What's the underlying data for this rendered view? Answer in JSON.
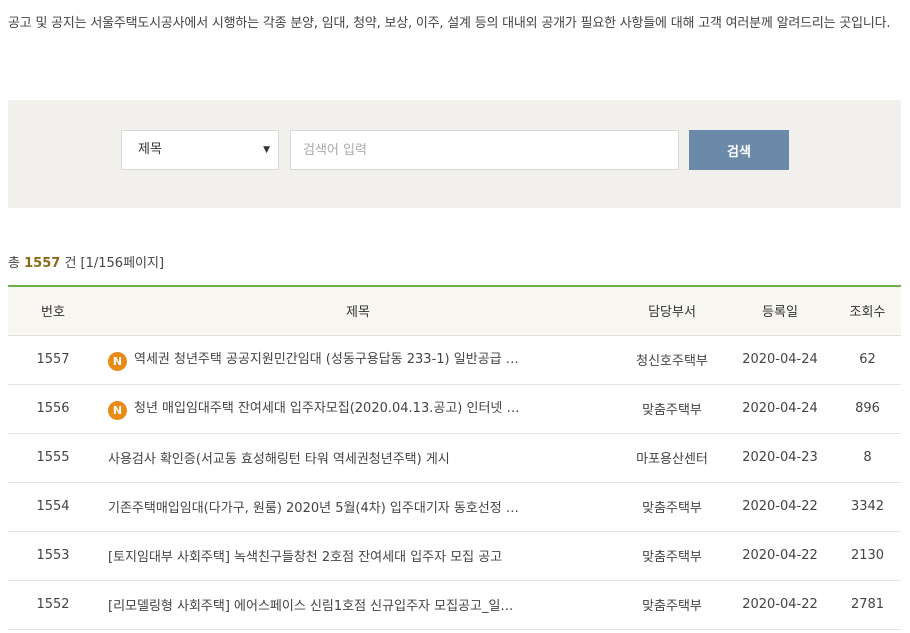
{
  "intro": {
    "text": "공고 및 공지는 서울주택도시공사에서 시행하는 각종 분양, 임대, 청약, 보상, 이주, 설계 등의 대내외 공개가 필요한 사항들에 대해 고객 여러분께 알려드리는 곳입니다."
  },
  "search": {
    "field_selected": "제목",
    "placeholder": "검색어 입력",
    "button_label": "검색"
  },
  "summary": {
    "prefix": "총",
    "count": "1557",
    "unit": "건",
    "pages": "[1/156페이지]"
  },
  "table": {
    "headers": {
      "no": "번호",
      "title": "제목",
      "dept": "담당부서",
      "date": "등록일",
      "views": "조회수"
    },
    "rows": [
      {
        "no": "1557",
        "new": "N",
        "title": "역세권 청년주택 공공지원민간임대 (성동구용답동 233-1) 일반공급 …",
        "dept": "청신호주택부",
        "date": "2020-04-24",
        "views": "62"
      },
      {
        "no": "1556",
        "new": "N",
        "title": "청년 매입임대주택 잔여세대 입주자모집(2020.04.13.공고) 인터넷 …",
        "dept": "맞춤주택부",
        "date": "2020-04-24",
        "views": "896"
      },
      {
        "no": "1555",
        "new": "",
        "title": "사용검사 확인증(서교동 효성해링턴 타워 역세권청년주택) 게시",
        "dept": "마포용산센터",
        "date": "2020-04-23",
        "views": "8"
      },
      {
        "no": "1554",
        "new": "",
        "title": "기존주택매입임대(다가구, 원룸) 2020년 5월(4차) 입주대기자 동호선정 …",
        "dept": "맞춤주택부",
        "date": "2020-04-22",
        "views": "3342"
      },
      {
        "no": "1553",
        "new": "",
        "title": "[토지임대부 사회주택] 녹색친구들창천 2호점 잔여세대 입주자 모집 공고",
        "dept": "맞춤주택부",
        "date": "2020-04-22",
        "views": "2130"
      },
      {
        "no": "1552",
        "new": "",
        "title": "[리모델링형 사회주택] 에어스페이스 신림1호점 신규입주자 모집공고_일…",
        "dept": "맞춤주택부",
        "date": "2020-04-22",
        "views": "2781"
      }
    ]
  },
  "colors": {
    "accent_green": "#6ab04c",
    "search_button": "#6b8aa9",
    "new_badge": "#e98a14",
    "count_highlight": "#8a6a1a"
  }
}
